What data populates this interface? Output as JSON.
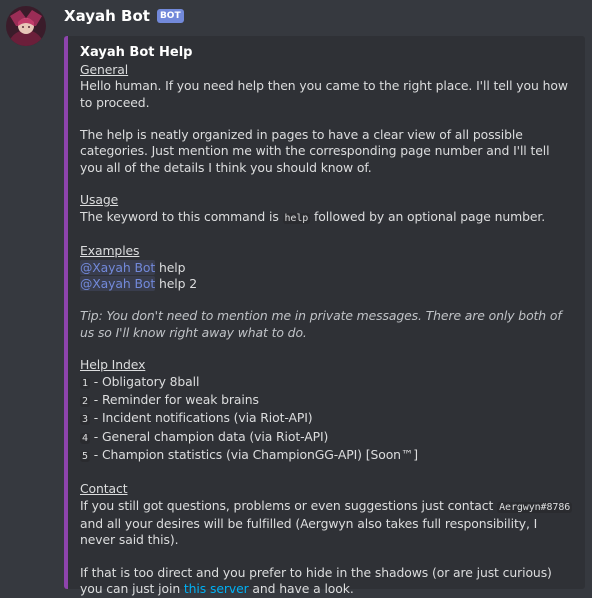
{
  "message": {
    "username": "Xayah Bot",
    "bot_tag": "BOT"
  },
  "embed": {
    "title": "Xayah Bot Help",
    "accent_color": "#8e44ad",
    "general": {
      "heading": "General",
      "line1": "Hello human. If you need help then you came to the right place. I'll tell you how to proceed.",
      "line2": "The help is neatly organized in pages to have a clear view of all possible categories. Just mention me with the corresponding page number and I'll tell you all of the details I think you should know of."
    },
    "usage": {
      "heading": "Usage",
      "text_before": "The keyword to this command is ",
      "keyword": "help",
      "text_after": " followed by an optional page number."
    },
    "examples": {
      "heading": "Examples",
      "mention": "@Xayah Bot",
      "example1": " help",
      "example2": " help 2"
    },
    "tip": "Tip: You don't need to mention me in private messages. There are only both of us so I'll know right away what to do.",
    "help_index": {
      "heading": "Help Index",
      "items": [
        {
          "num": "1",
          "label": " - Obligatory 8ball"
        },
        {
          "num": "2",
          "label": " - Reminder for weak brains"
        },
        {
          "num": "3",
          "label": " - Incident notifications (via Riot-API)"
        },
        {
          "num": "4",
          "label": " - General champion data (via Riot-API)"
        },
        {
          "num": "5",
          "label": " - Champion statistics (via ChampionGG-API) [Soon™]"
        }
      ]
    },
    "contact": {
      "heading": "Contact",
      "text_before": "If you still got questions, problems or even suggestions just contact ",
      "handle": "Aergwyn#8786",
      "text_after": " and all your desires will be fulfilled (Aergwyn also takes full responsibility, I never said this).",
      "join_before": "If that is too direct and you prefer to hide in the shadows (or are just curious) you can just join ",
      "link_text": "this server",
      "join_after": " and have a look."
    }
  }
}
